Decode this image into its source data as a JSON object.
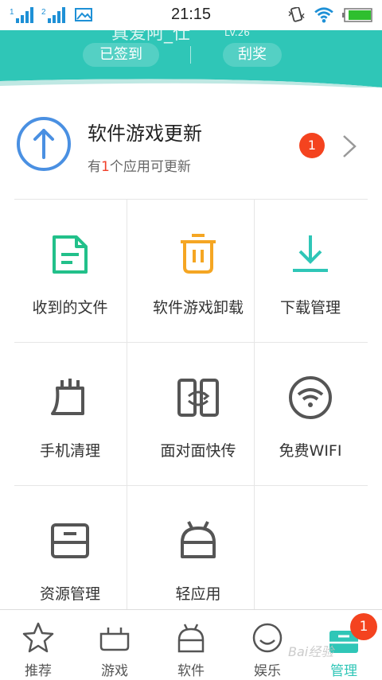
{
  "status_bar": {
    "time": "21:15",
    "sim1": "1",
    "sim2": "2"
  },
  "header": {
    "username": "真爱阿_仕",
    "level": "Lv.26",
    "checked_in": "已签到",
    "scratch": "刮奖",
    "accent": "#2fc6b7"
  },
  "update": {
    "title": "软件游戏更新",
    "sub_prefix": "有",
    "sub_count": "1",
    "sub_suffix": "个应用可更新",
    "badge": "1"
  },
  "grid": {
    "items": [
      {
        "label": "收到的文件",
        "icon": "file-received-icon",
        "color": "#22c08a"
      },
      {
        "label": "软件游戏卸载",
        "icon": "trash-icon",
        "color": "#f5a623"
      },
      {
        "label": "下载管理",
        "icon": "download-icon",
        "color": "#2fc6b7"
      },
      {
        "label": "手机清理",
        "icon": "broom-icon",
        "color": "#555555"
      },
      {
        "label": "面对面快传",
        "icon": "transfer-icon",
        "color": "#555555"
      },
      {
        "label": "免费WIFI",
        "icon": "wifi-icon",
        "color": "#555555"
      },
      {
        "label": "资源管理",
        "icon": "storage-icon",
        "color": "#555555"
      },
      {
        "label": "轻应用",
        "icon": "android-icon",
        "color": "#555555"
      }
    ]
  },
  "tabs": [
    {
      "label": "推荐",
      "icon": "star-icon"
    },
    {
      "label": "游戏",
      "icon": "gamepad-icon"
    },
    {
      "label": "软件",
      "icon": "android-icon"
    },
    {
      "label": "娱乐",
      "icon": "smiley-icon"
    },
    {
      "label": "管理",
      "icon": "manage-icon"
    }
  ],
  "tab_badge": "1",
  "watermark": "Bai经验"
}
